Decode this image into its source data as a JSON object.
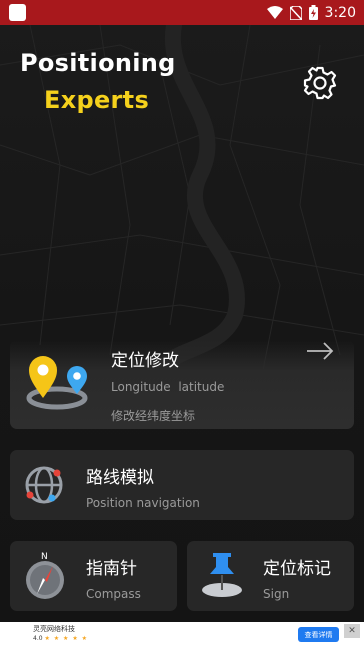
{
  "status_bar": {
    "time": "3:20"
  },
  "header": {
    "title_line1": "Positioning",
    "title_line2": "Experts",
    "settings_icon": "gear-icon"
  },
  "cards": {
    "modify": {
      "title": "定位修改",
      "subtitle1": "Longitude  latitude",
      "subtitle2": "修改经纬度坐标",
      "icon": "map-pins-icon"
    },
    "route": {
      "title": "路线模拟",
      "subtitle": "Position navigation",
      "icon": "globe-icon"
    },
    "compass": {
      "title": "指南针",
      "subtitle": "Compass",
      "icon": "compass-icon"
    },
    "sign": {
      "title": "定位标记",
      "subtitle": "Sign",
      "icon": "pushpin-icon"
    }
  },
  "ad": {
    "title": "灵亮网络科技",
    "rating": "4.0",
    "stars": "★ ★ ★ ★ ★",
    "button_label": "查看详情",
    "close": "✕"
  },
  "colors": {
    "status_bar": "#a8181c",
    "accent_yellow": "#f5d11c",
    "ad_button": "#1f7af0"
  }
}
